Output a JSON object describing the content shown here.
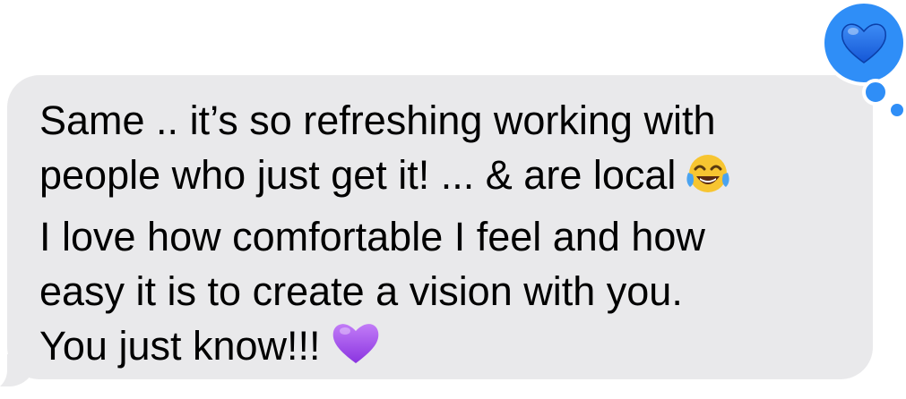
{
  "message": {
    "lines": [
      "Same .. it’s so refreshing working with",
      "people who just get it! ... & are local",
      "I love how comfortable I feel and how",
      "easy it is to create a vision with you.",
      "You just know!!!"
    ],
    "inline_emojis": [
      "tears-of-joy-emoji",
      "purple-heart-emoji"
    ]
  },
  "tapback": {
    "icon": "blue-heart-icon"
  },
  "colors": {
    "bubble": "#e9e9eb",
    "tapback": "#2f8ef7",
    "blue_heart": "#1f6fe3",
    "purple_heart": "#a84ef0",
    "laugh_face": "#f7c531"
  }
}
